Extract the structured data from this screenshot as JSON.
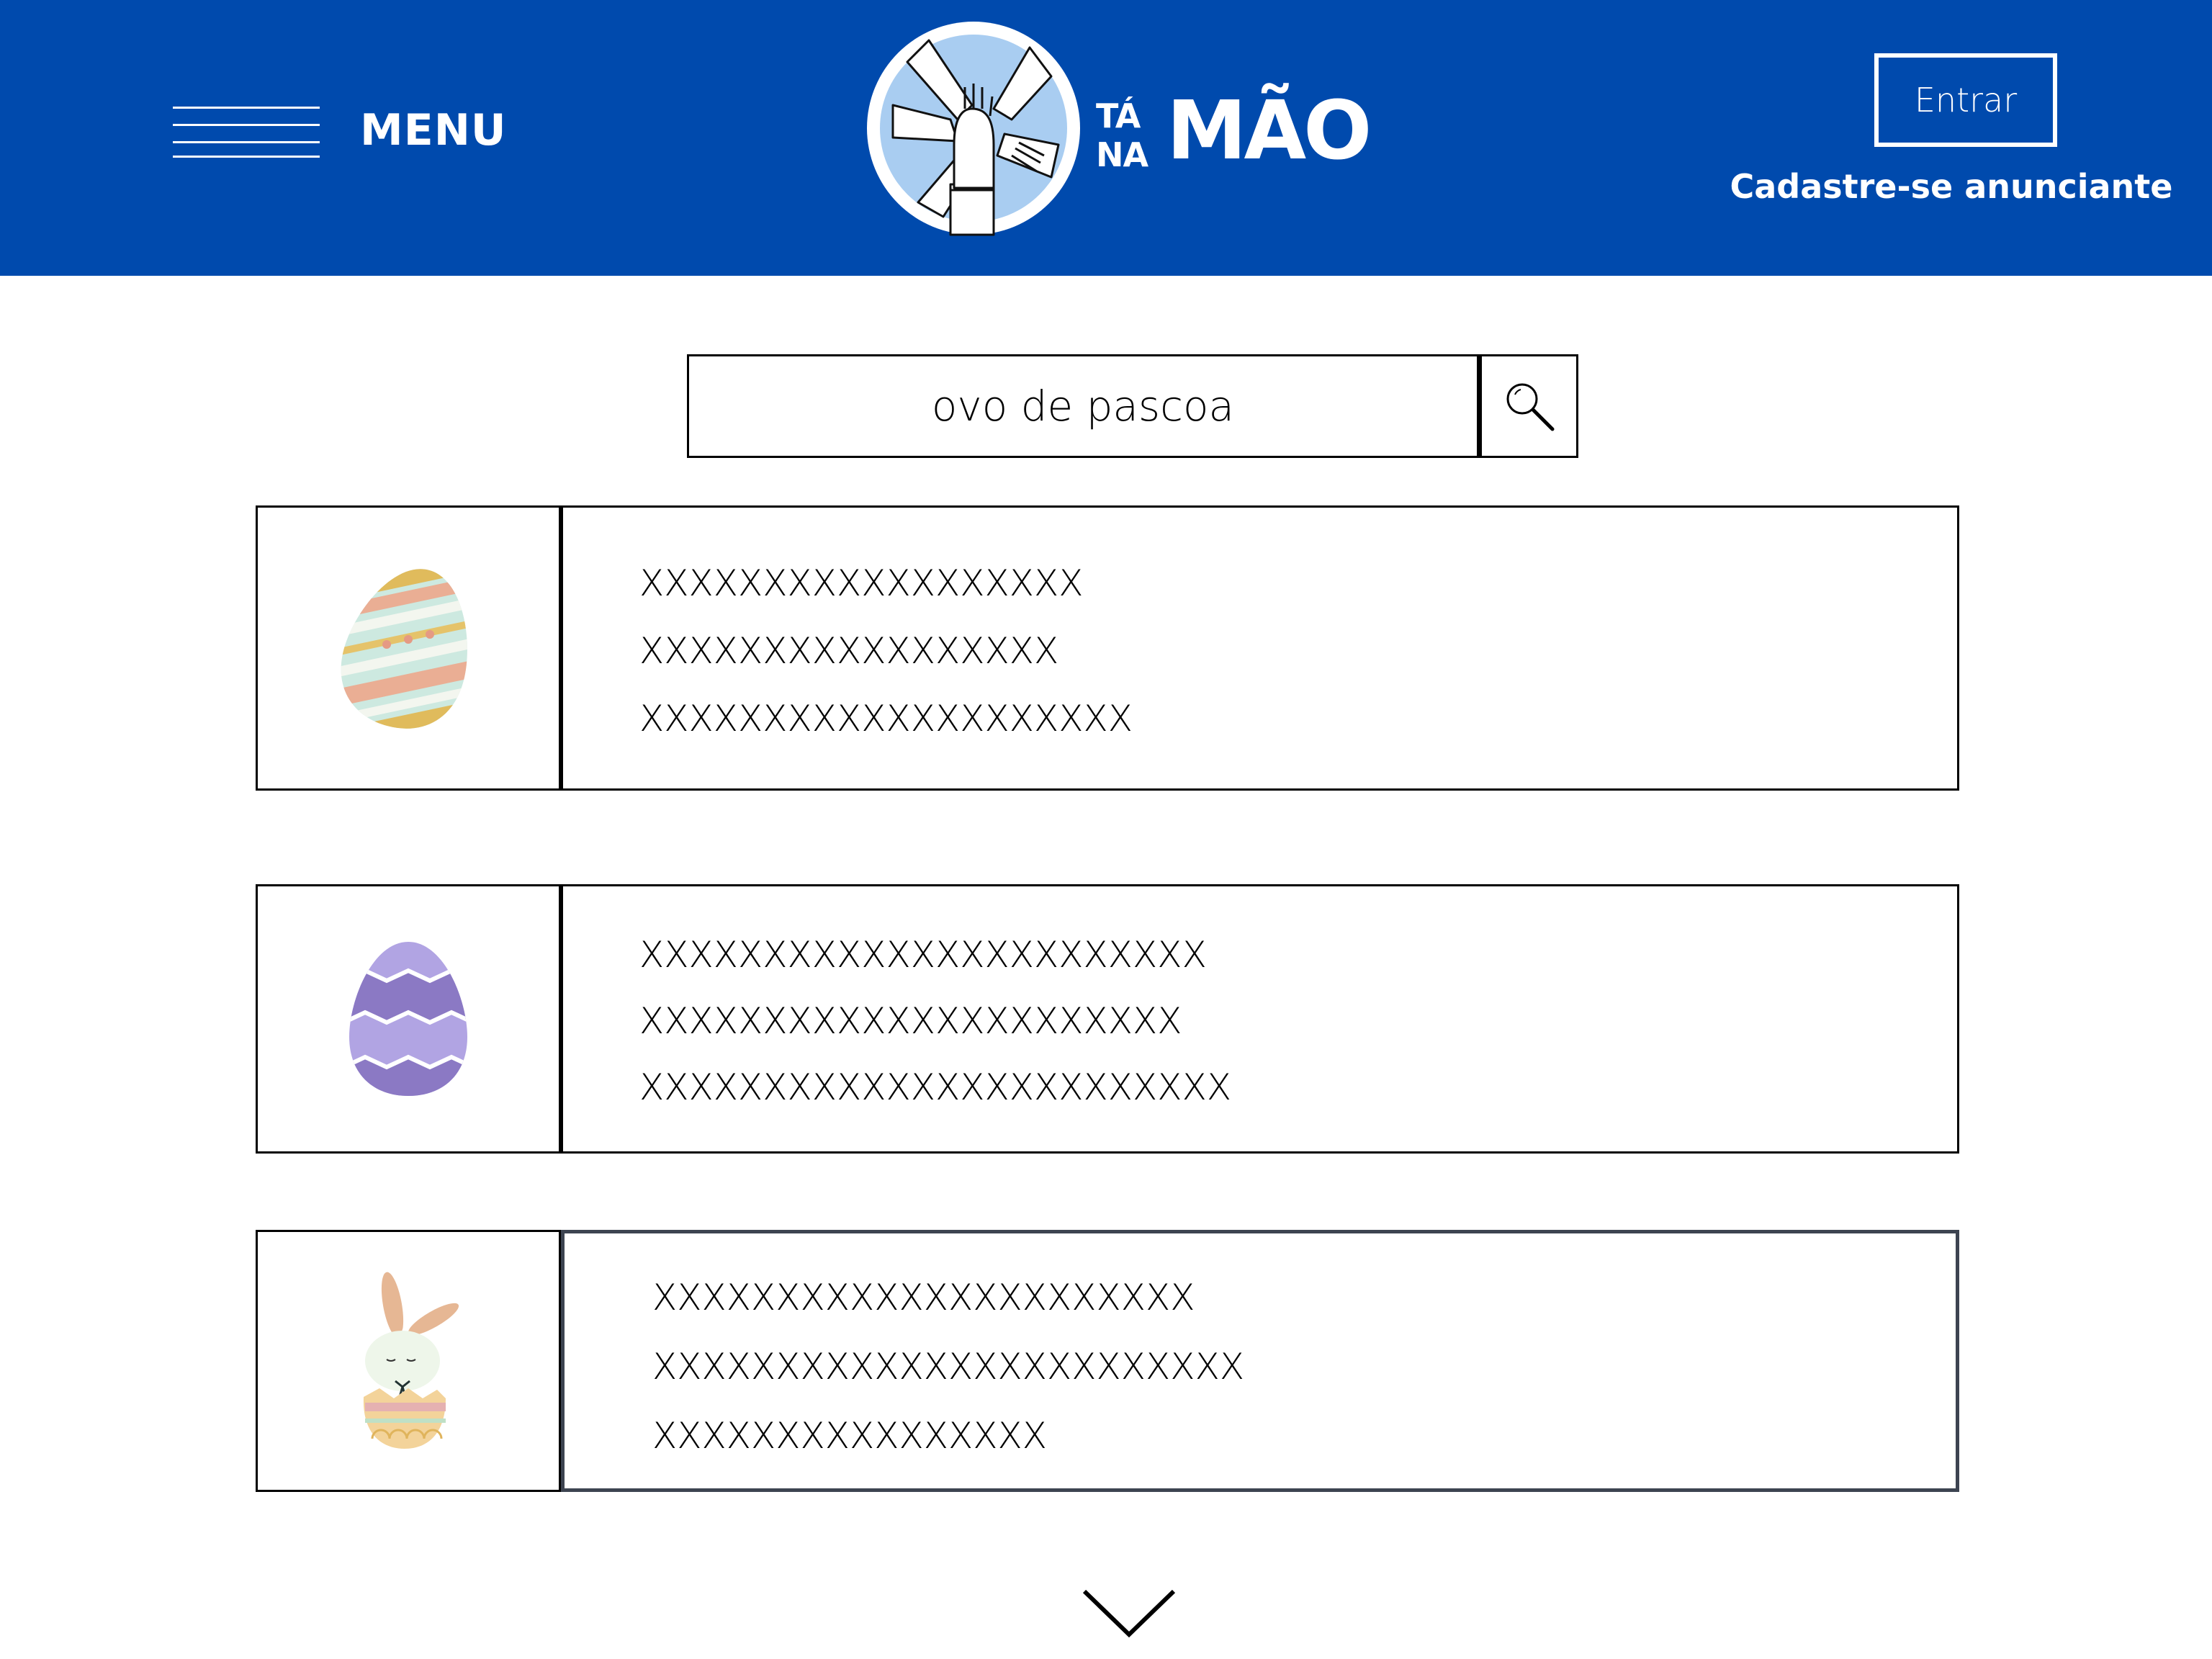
{
  "header": {
    "menu_label": "MENU",
    "logo": {
      "word_ta": "TÁ",
      "word_na": "NA",
      "word_mao": "MÃO"
    },
    "login_label": "Entrar",
    "signup_label": "Cadastre-se anunciante"
  },
  "search": {
    "value": "ovo de pascoa",
    "button_icon": "magnifier-icon"
  },
  "results": [
    {
      "image_icon": "easter-egg-striped-icon",
      "lines": [
        "XXXXXXXXXXXXXXXXXX",
        "XXXXXXXXXXXXXXXXX",
        "XXXXXXXXXXXXXXXXXXXX"
      ]
    },
    {
      "image_icon": "easter-egg-purple-icon",
      "lines": [
        "XXXXXXXXXXXXXXXXXXXXXXX",
        "XXXXXXXXXXXXXXXXXXXXXX",
        "XXXXXXXXXXXXXXXXXXXXXXXX"
      ]
    },
    {
      "image_icon": "easter-bunny-egg-icon",
      "lines": [
        "XXXXXXXXXXXXXXXXXXXXXX",
        "XXXXXXXXXXXXXXXXXXXXXXXX",
        "XXXXXXXXXXXXXXXX"
      ]
    }
  ],
  "footer": {
    "more_icon": "chevron-down-icon"
  },
  "colors": {
    "header_bg": "#004aad",
    "text": "#000000",
    "white": "#ffffff"
  }
}
